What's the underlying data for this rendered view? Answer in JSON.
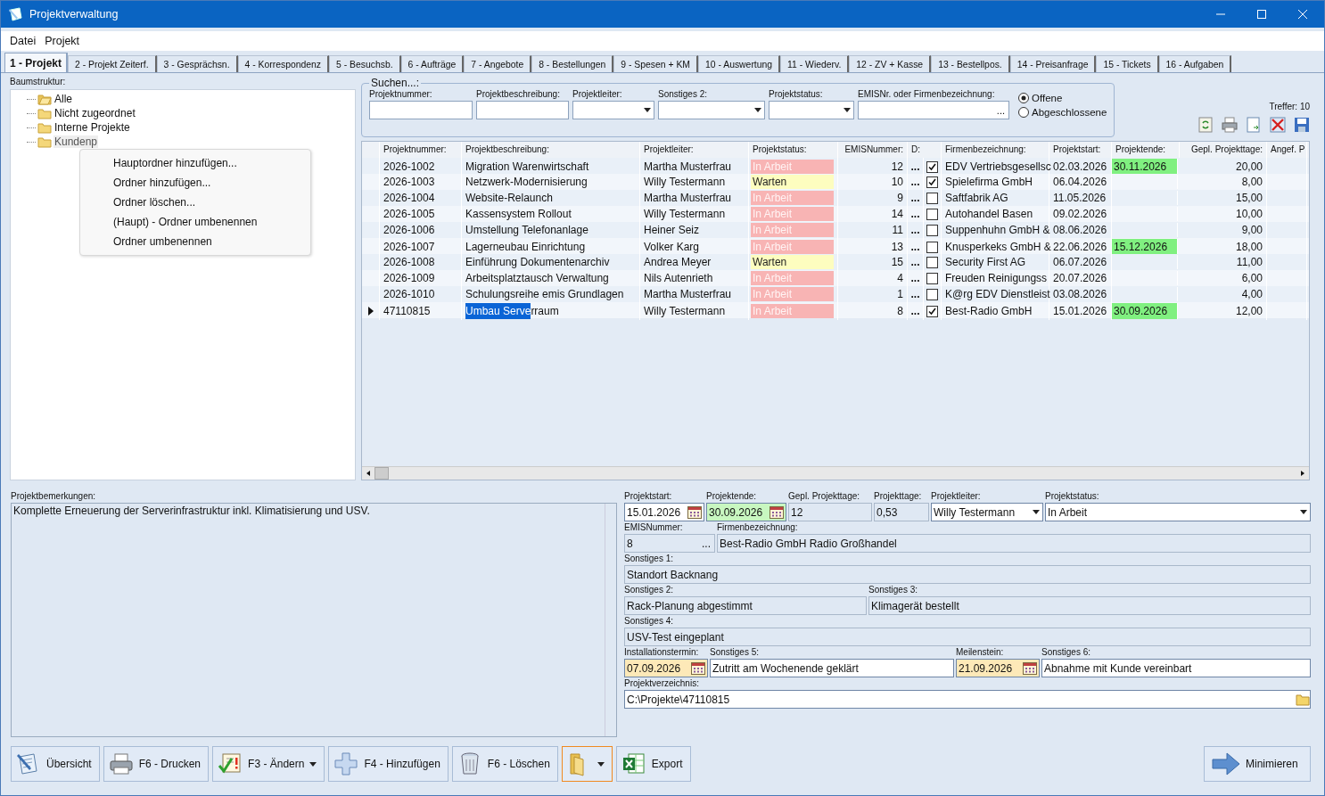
{
  "window": {
    "title": "Projektverwaltung"
  },
  "menu": [
    "Datei",
    "Projekt"
  ],
  "tabs": [
    {
      "label": "1 - Projekt",
      "selected": true
    },
    {
      "label": "2 - Projekt Zeiterf.",
      "selected": false
    },
    {
      "label": "3 - Gesprächsn.",
      "selected": false
    },
    {
      "label": "4 - Korrespondenz",
      "selected": false
    },
    {
      "label": "5 - Besuchsb.",
      "selected": false
    },
    {
      "label": "6 - Aufträge",
      "selected": false
    },
    {
      "label": "7 - Angebote",
      "selected": false
    },
    {
      "label": "8 - Bestellungen",
      "selected": false
    },
    {
      "label": "9 - Spesen + KM",
      "selected": false
    },
    {
      "label": "10 - Auswertung",
      "selected": false
    },
    {
      "label": "11 - Wiederv.",
      "selected": false
    },
    {
      "label": "12 - ZV + Kasse",
      "selected": false
    },
    {
      "label": "13 - Bestellpos.",
      "selected": false
    },
    {
      "label": "14 - Preisanfrage",
      "selected": false
    },
    {
      "label": "15 - Tickets",
      "selected": false
    },
    {
      "label": "16 - Aufgaben",
      "selected": false
    }
  ],
  "tree": {
    "label": "Baumstruktur:",
    "items": [
      {
        "label": "Alle",
        "open": true,
        "selected": false
      },
      {
        "label": "Nicht zugeordnet",
        "open": false,
        "selected": false
      },
      {
        "label": "Interne Projekte",
        "open": false,
        "selected": false
      },
      {
        "label": "Kundenp",
        "open": false,
        "selected": true
      }
    ]
  },
  "context_menu": [
    "Hauptordner hinzufügen...",
    "Ordner hinzufügen...",
    "Ordner löschen...",
    "(Haupt) - Ordner umbenennen",
    "Ordner umbenennen"
  ],
  "search": {
    "legend": "Suchen...:",
    "fields": [
      {
        "label": "Projektnummer:",
        "kind": "text"
      },
      {
        "label": "Projektbeschreibung:",
        "kind": "text"
      },
      {
        "label": "Projektleiter:",
        "kind": "dropdown"
      },
      {
        "label": "Sonstiges 2:",
        "kind": "dropdown"
      },
      {
        "label": "Projektstatus:",
        "kind": "dropdown"
      },
      {
        "label": "EMISNr. oder Firmenbezeichnung:",
        "kind": "lookup",
        "button": "..."
      }
    ],
    "radios": [
      {
        "label": "Offene",
        "selected": true
      },
      {
        "label": "Abgeschlossene",
        "selected": false
      }
    ],
    "hits": "Treffer: 10"
  },
  "table": {
    "columns": [
      "Projektnummer:",
      "Projektbeschreibung:",
      "Projektleiter:",
      "Projektstatus:",
      "EMISNummer:",
      "D:",
      "Firmenbezeichnung:",
      "Projektstart:",
      "Projektende:",
      "Gepl. Projekttage:",
      "Angef. P"
    ],
    "rows": [
      {
        "number": "2026-1002",
        "description": "Migration Warenwirtschaft",
        "leader": "Martha Musterfrau",
        "status": "In Arbeit",
        "color": "#f8b4b4",
        "emis": "12",
        "dots": "...",
        "d_checked": true,
        "company": "EDV Vertriebsgesellsc",
        "start": "02.03.2026",
        "end": "30.11.2026",
        "end_highlighted": true,
        "planned_days": "20,00",
        "selected": false
      },
      {
        "number": "2026-1003",
        "description": "Netzwerk-Modernisierung",
        "leader": "Willy Testermann",
        "status": "Warten",
        "color": "#fdfdbf",
        "emis": "10",
        "dots": "...",
        "d_checked": true,
        "company": "Spielefirma GmbH",
        "start": "06.04.2026",
        "end_highlighted": false,
        "planned_days": "8,00",
        "selected": false
      },
      {
        "number": "2026-1004",
        "description": "Website-Relaunch",
        "leader": "Martha Musterfrau",
        "status": "In Arbeit",
        "color": "#f8b4b4",
        "emis": "9",
        "dots": "...",
        "d_checked": false,
        "company": "Saftfabrik AG",
        "start": "11.05.2026",
        "end_highlighted": false,
        "planned_days": "15,00",
        "selected": false
      },
      {
        "number": "2026-1005",
        "description": "Kassensystem Rollout",
        "leader": "Willy Testermann",
        "status": "In Arbeit",
        "color": "#f8b4b4",
        "emis": "14",
        "dots": "...",
        "d_checked": false,
        "company": "Autohandel Basen",
        "start": "09.02.2026",
        "end_highlighted": false,
        "planned_days": "10,00",
        "selected": false
      },
      {
        "number": "2026-1006",
        "description": "Umstellung Telefonanlage",
        "leader": "Heiner Seiz",
        "status": "In Arbeit",
        "color": "#f8b4b4",
        "emis": "11",
        "dots": "...",
        "d_checked": false,
        "company": "Suppenhuhn GmbH &",
        "start": "08.06.2026",
        "end_highlighted": false,
        "planned_days": "9,00",
        "selected": false
      },
      {
        "number": "2026-1007",
        "description": "Lagerneubau Einrichtung",
        "leader": "Volker Karg",
        "status": "In Arbeit",
        "color": "#f8b4b4",
        "emis": "13",
        "dots": "...",
        "d_checked": false,
        "company": "Knusperkeks GmbH &",
        "start": "22.06.2026",
        "end": "15.12.2026",
        "end_highlighted": true,
        "planned_days": "18,00",
        "selected": false
      },
      {
        "number": "2026-1008",
        "description": "Einführung Dokumentenarchiv",
        "leader": "Andrea Meyer",
        "status": "Warten",
        "color": "#fdfdbf",
        "emis": "15",
        "dots": "...",
        "d_checked": false,
        "company": "Security First AG",
        "start": "06.07.2026",
        "end_highlighted": false,
        "planned_days": "11,00",
        "selected": false
      },
      {
        "number": "2026-1009",
        "description": "Arbeitsplatztausch Verwaltung",
        "leader": "Nils Autenrieth",
        "status": "In Arbeit",
        "color": "#f8b4b4",
        "emis": "4",
        "dots": "...",
        "d_checked": false,
        "company": "Freuden Reinigungss",
        "start": "20.07.2026",
        "end_highlighted": false,
        "planned_days": "6,00",
        "selected": false
      },
      {
        "number": "2026-1010",
        "description": "Schulungsreihe emis Grundlagen",
        "leader": "Martha Musterfrau",
        "status": "In Arbeit",
        "color": "#f8b4b4",
        "emis": "1",
        "dots": "...",
        "d_checked": false,
        "company": "K@rg EDV Dienstleist",
        "start": "03.08.2026",
        "end_highlighted": false,
        "planned_days": "4,00",
        "selected": false
      },
      {
        "number": "47110815",
        "description_highlight": "Umbau Serve",
        "description": "rraum",
        "leader": "Willy Testermann",
        "status": "In Arbeit",
        "color": "#f8b4b4",
        "emis": "8",
        "dots": "...",
        "d_checked": true,
        "company": "Best-Radio GmbH",
        "start": "15.01.2026",
        "end": "30.09.2026",
        "end_highlighted": true,
        "planned_days": "12,00",
        "selected": true
      }
    ]
  },
  "remarks": {
    "label": "Projektbemerkungen:",
    "value": "Komplette Erneuerung der Serverinfrastruktur inkl. Klimatisierung und USV."
  },
  "form_rows": [
    [
      {
        "label": "Projektstart:",
        "value": "15.01.2026",
        "kind": "date",
        "readonly": false
      },
      {
        "label": "Projektende:",
        "value": "30.09.2026",
        "kind": "date",
        "readonly": false,
        "color": "#c8f7c0"
      },
      {
        "label": "Gepl. Projekttage:",
        "value": "12",
        "kind": "text",
        "readonly": true
      },
      {
        "label": "Projekttage:",
        "value": "0,53",
        "kind": "text",
        "readonly": true
      },
      {
        "label": "Projektleiter:",
        "value": "Willy Testermann",
        "kind": "dropdown",
        "readonly": false
      },
      {
        "label": "Projektstatus:",
        "value": "In Arbeit",
        "kind": "dropdown",
        "readonly": false
      }
    ],
    [
      {
        "label": "EMISNummer:",
        "value": "8",
        "kind": "lookup",
        "button": "...",
        "readonly": true
      },
      {
        "label": "Firmenbezeichnung:",
        "value": "Best-Radio GmbH Radio Großhandel",
        "kind": "text",
        "readonly": true
      }
    ],
    [
      {
        "label": "Sonstiges 1:",
        "value": "Standort Backnang",
        "kind": "text",
        "readonly": true
      }
    ],
    [
      {
        "label": "Sonstiges 2:",
        "value": "Rack-Planung abgestimmt",
        "kind": "text",
        "readonly": true
      },
      {
        "label": "Sonstiges 3:",
        "value": "Klimagerät bestellt",
        "kind": "text",
        "readonly": true
      }
    ],
    [
      {
        "label": "Sonstiges 4:",
        "value": "USV-Test eingeplant",
        "kind": "text",
        "readonly": true
      }
    ],
    [
      {
        "label": "Installationstermin:",
        "value": "07.09.2026",
        "kind": "date",
        "readonly": false,
        "color": "#fde9b8"
      },
      {
        "label": "Sonstiges 5:",
        "value": "Zutritt am Wochenende geklärt",
        "kind": "text",
        "readonly": false
      },
      {
        "label": "Meilenstein:",
        "value": "21.09.2026",
        "kind": "date",
        "readonly": false,
        "color": "#fde9b8"
      },
      {
        "label": "Sonstiges 6:",
        "value": "Abnahme mit Kunde vereinbart",
        "kind": "text",
        "readonly": false
      }
    ],
    [
      {
        "label": "Projektverzeichnis:",
        "value": "C:\\Projekte\\47110815",
        "kind": "folder",
        "readonly": false
      }
    ]
  ],
  "buttons": [
    {
      "label": "Übersicht",
      "dropdown": false,
      "focused": false
    },
    {
      "label": "F6 - Drucken",
      "dropdown": false,
      "focused": false
    },
    {
      "label": "F3 - Ändern",
      "dropdown": true,
      "focused": false
    },
    {
      "label": "F4 - Hinzufügen",
      "dropdown": false,
      "focused": false
    },
    {
      "label": "F6 - Löschen",
      "dropdown": false,
      "focused": false
    },
    {
      "dropdown": true,
      "focused": true
    },
    {
      "label": "Export",
      "dropdown": false,
      "focused": false
    }
  ],
  "minimize_button": {
    "label": "Minimieren"
  }
}
